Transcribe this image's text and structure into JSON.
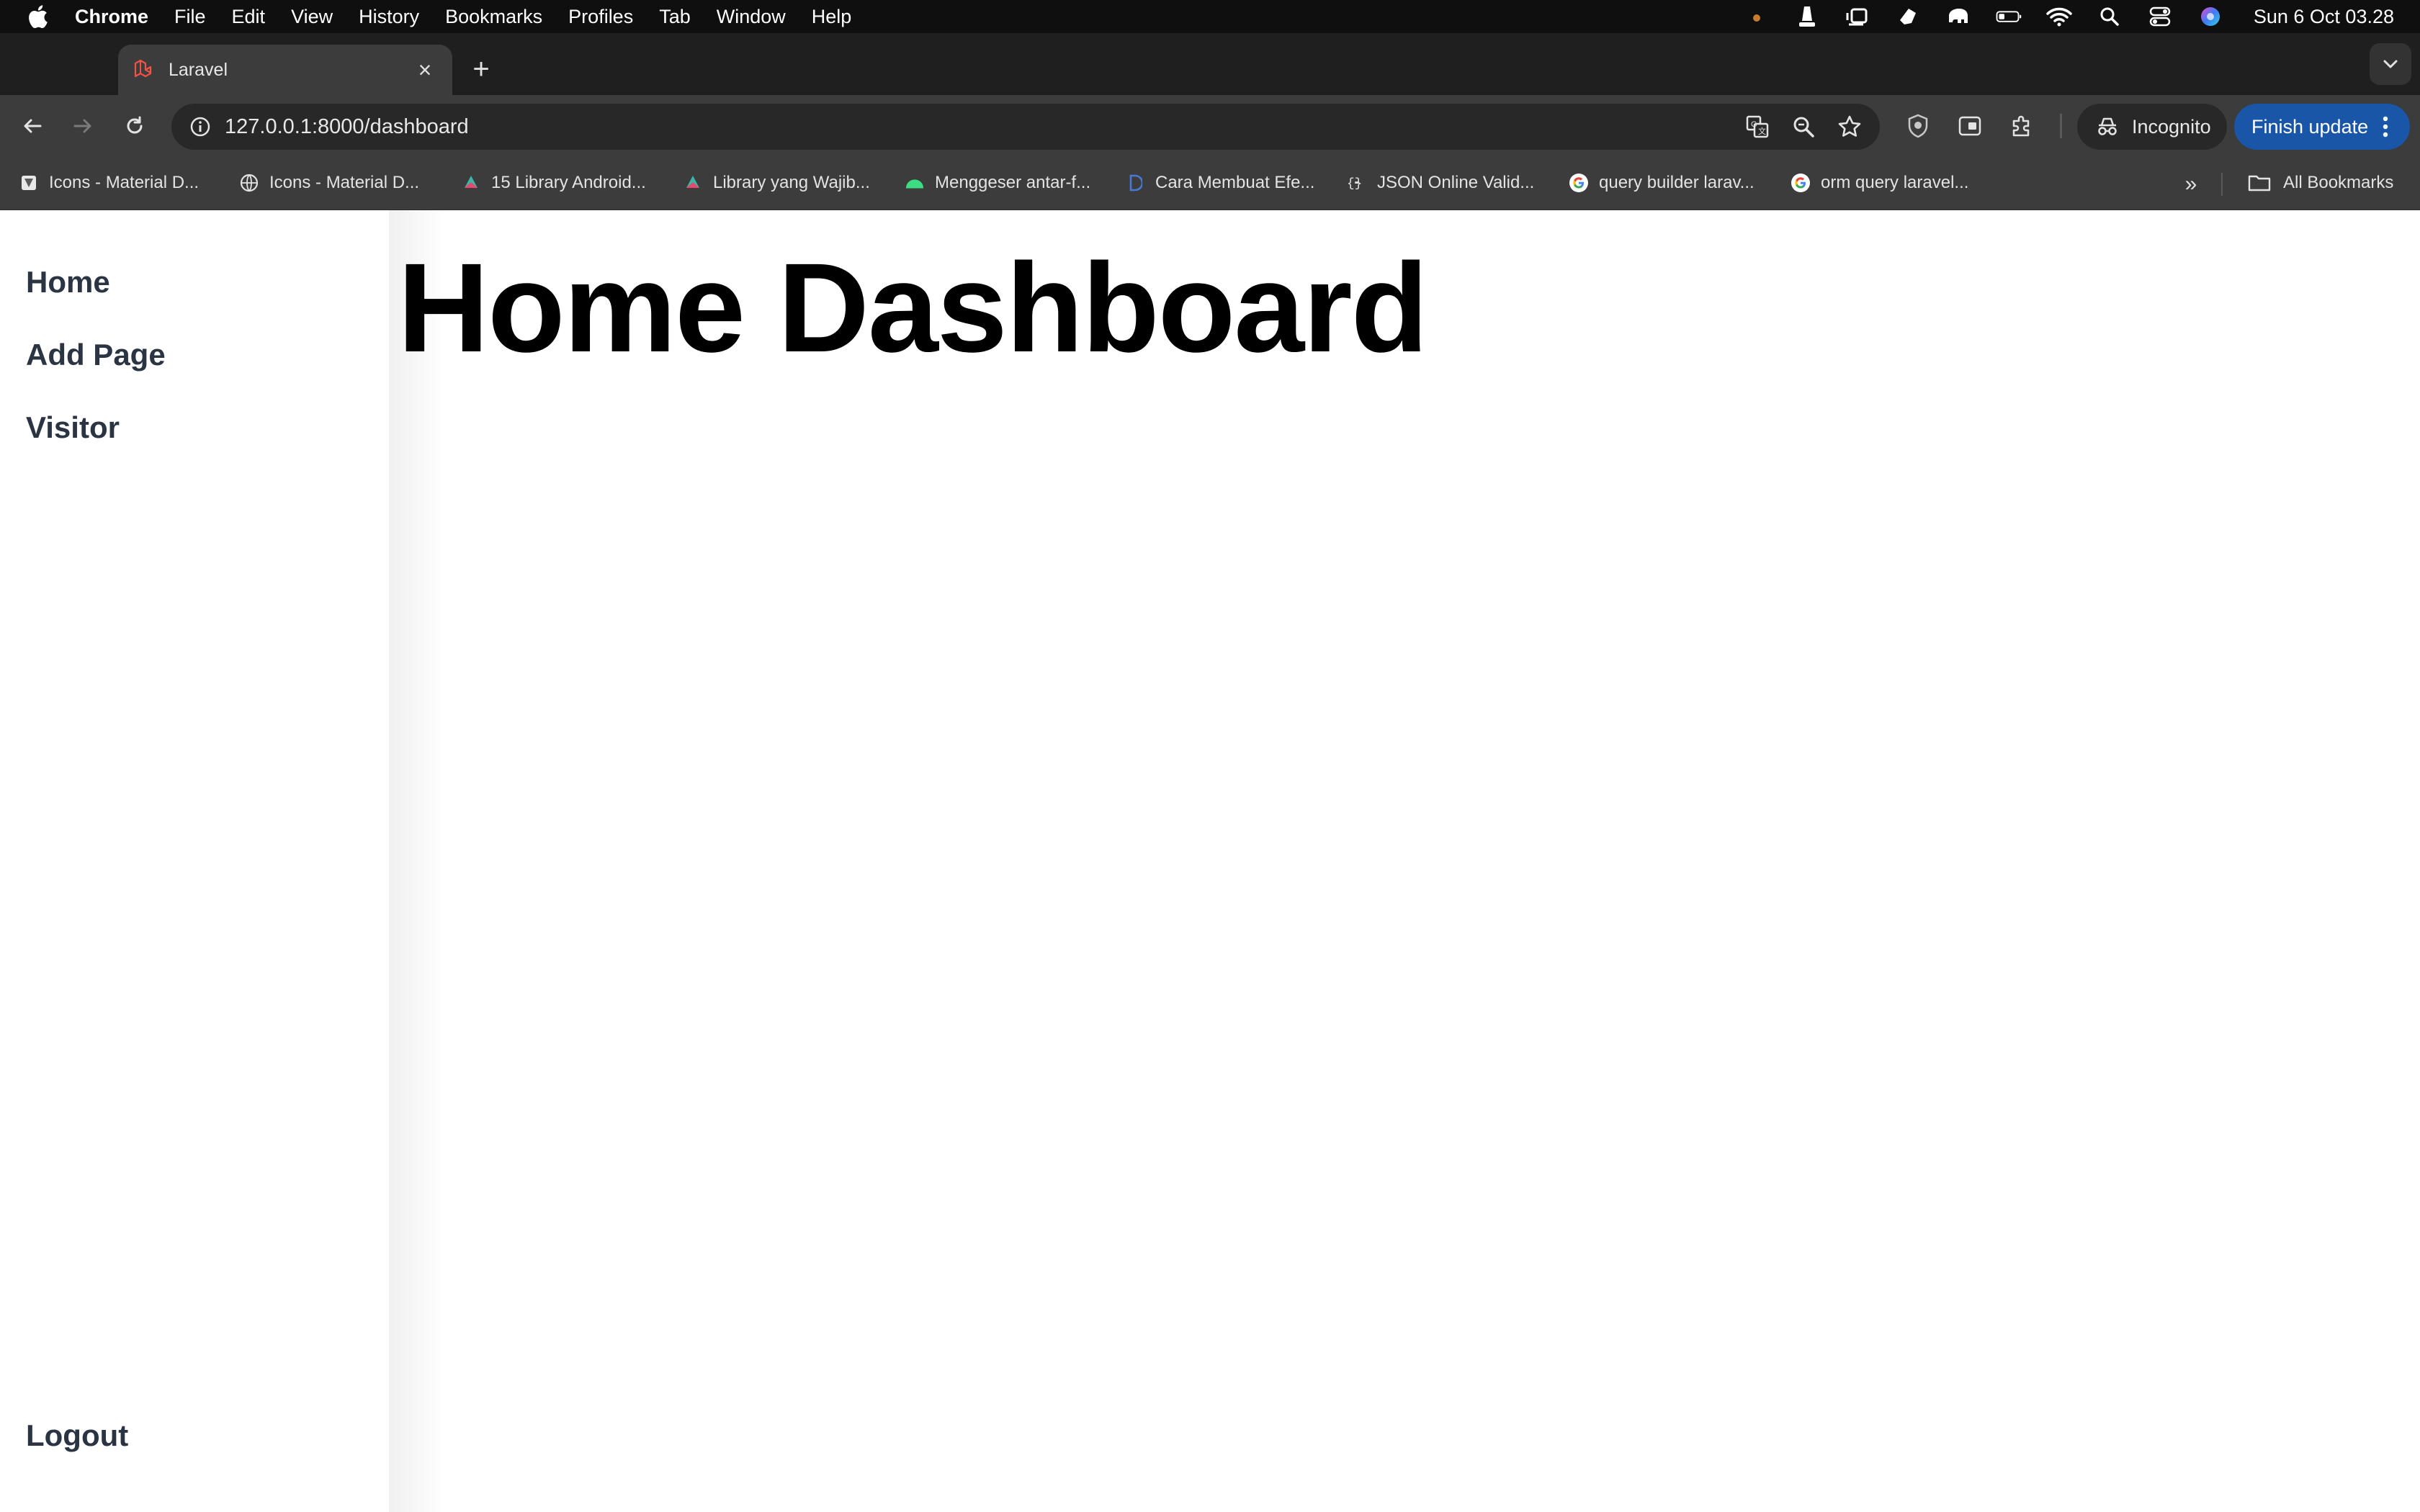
{
  "menubar": {
    "apple_icon": "apple-logo-icon",
    "app_name": "Chrome",
    "items": [
      "File",
      "Edit",
      "View",
      "History",
      "Bookmarks",
      "Profiles",
      "Tab",
      "Window",
      "Help"
    ],
    "status_icons": [
      "recording-dot-icon",
      "vlc-cone-icon",
      "stage-manager-icon",
      "app-icon",
      "elephant-icon",
      "battery-icon",
      "wifi-icon",
      "spotlight-search-icon",
      "control-center-icon",
      "siri-icon"
    ],
    "clock": "Sun 6 Oct  03.28"
  },
  "tabs": [
    {
      "title": "Laravel",
      "favicon": "laravel-icon"
    }
  ],
  "toolbar": {
    "url": "127.0.0.1:8000/dashboard",
    "incognito_label": "Incognito",
    "update_label": "Finish update"
  },
  "bookmarks": {
    "items": [
      {
        "label": "Icons - Material D...",
        "icon": "material-icon"
      },
      {
        "label": "Icons - Material D...",
        "icon": "globe-icon"
      },
      {
        "label": "15 Library Android...",
        "icon": "codepolitan-icon"
      },
      {
        "label": "Library yang Wajib...",
        "icon": "codepolitan-icon"
      },
      {
        "label": "Menggeser antar-f...",
        "icon": "android-icon"
      },
      {
        "label": "Cara Membuat Efe...",
        "icon": "dev-icon"
      },
      {
        "label": "JSON Online Valid...",
        "icon": "json-icon"
      },
      {
        "label": "query builder larav...",
        "icon": "google-icon"
      },
      {
        "label": "orm query laravel...",
        "icon": "google-icon"
      }
    ],
    "all_label": "All Bookmarks"
  },
  "sidebar": {
    "home": "Home",
    "add_page": "Add Page",
    "visitor": "Visitor",
    "logout": "Logout"
  },
  "main": {
    "heading": "Home Dashboard"
  },
  "colors": {
    "menubar_bg": "#0f0f0f",
    "chrome_toolbar": "#3c3c3c",
    "update_button": "#1a56a8",
    "sidebar_text": "#2b3443",
    "heading_text": "#000000"
  }
}
